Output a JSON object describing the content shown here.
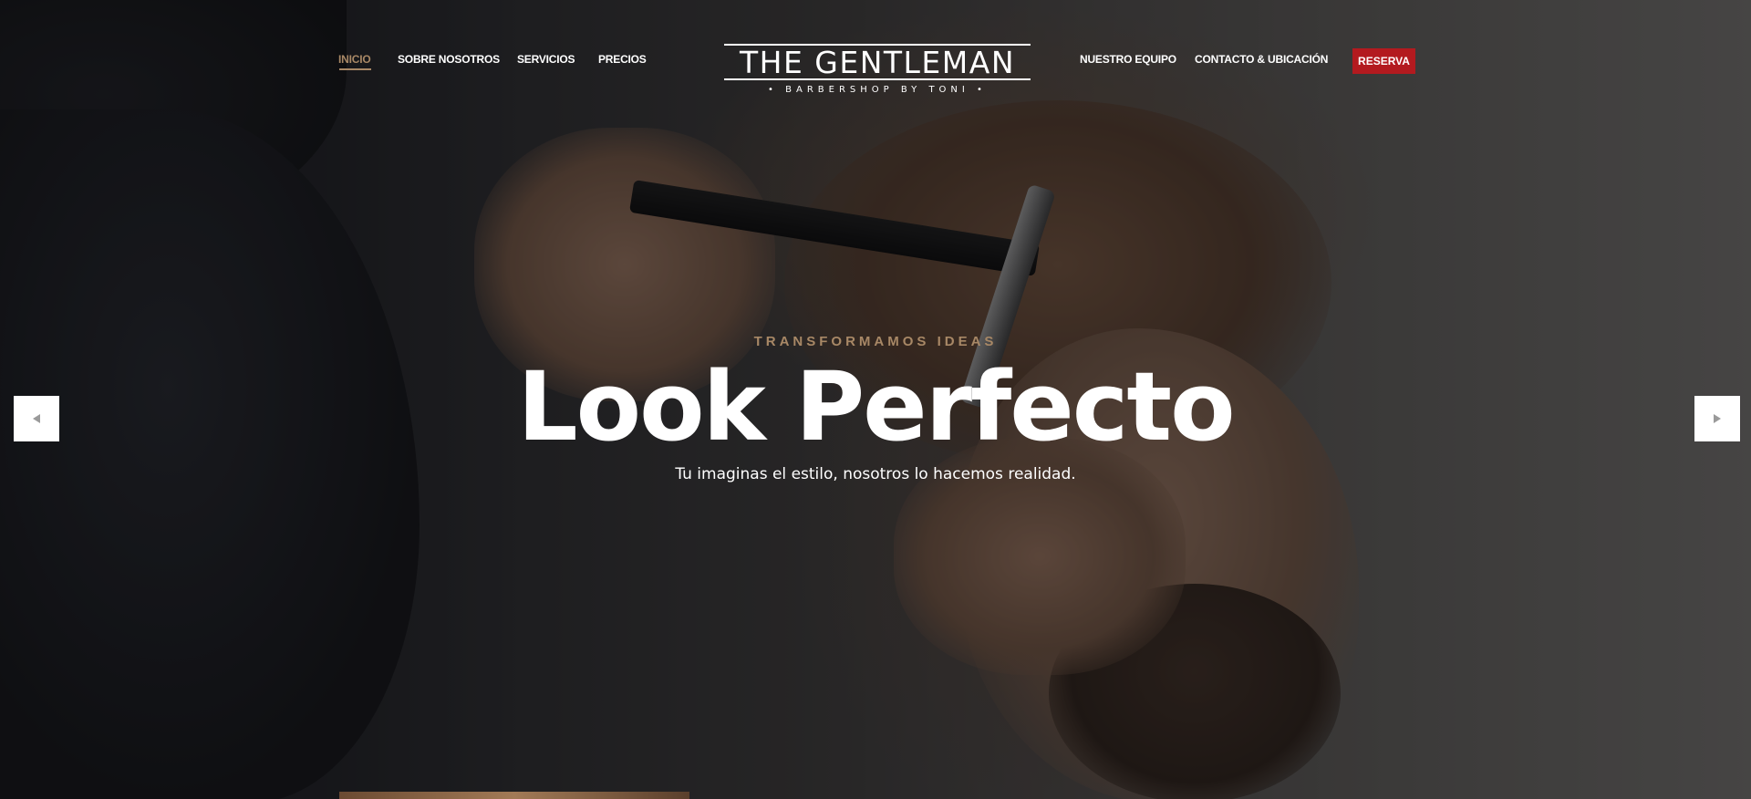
{
  "nav": {
    "left_links": [
      "INICIO",
      "SOBRE NOSOTROS",
      "SERVICIOS",
      "PRECIOS"
    ],
    "right_links": [
      "NUESTRO EQUIPO",
      "CONTACTO & UBICACIÓN"
    ],
    "active_link": "INICIO",
    "cta_label": "RESERVA"
  },
  "logo": {
    "title": "THE GENTLEMAN",
    "subtitle": "• BARBERSHOP BY TONI •"
  },
  "hero": {
    "eyebrow": "TRANSFORMAMOS IDEAS",
    "headline": "Look Perfecto",
    "subline": "Tu imaginas el estilo, nosotros lo hacemos realidad."
  },
  "slider": {
    "prev_icon": "arrow-left-icon",
    "next_icon": "arrow-right-icon"
  },
  "colors": {
    "accent": "#a88866",
    "cta": "#b31a1f",
    "text": "#ffffff"
  }
}
